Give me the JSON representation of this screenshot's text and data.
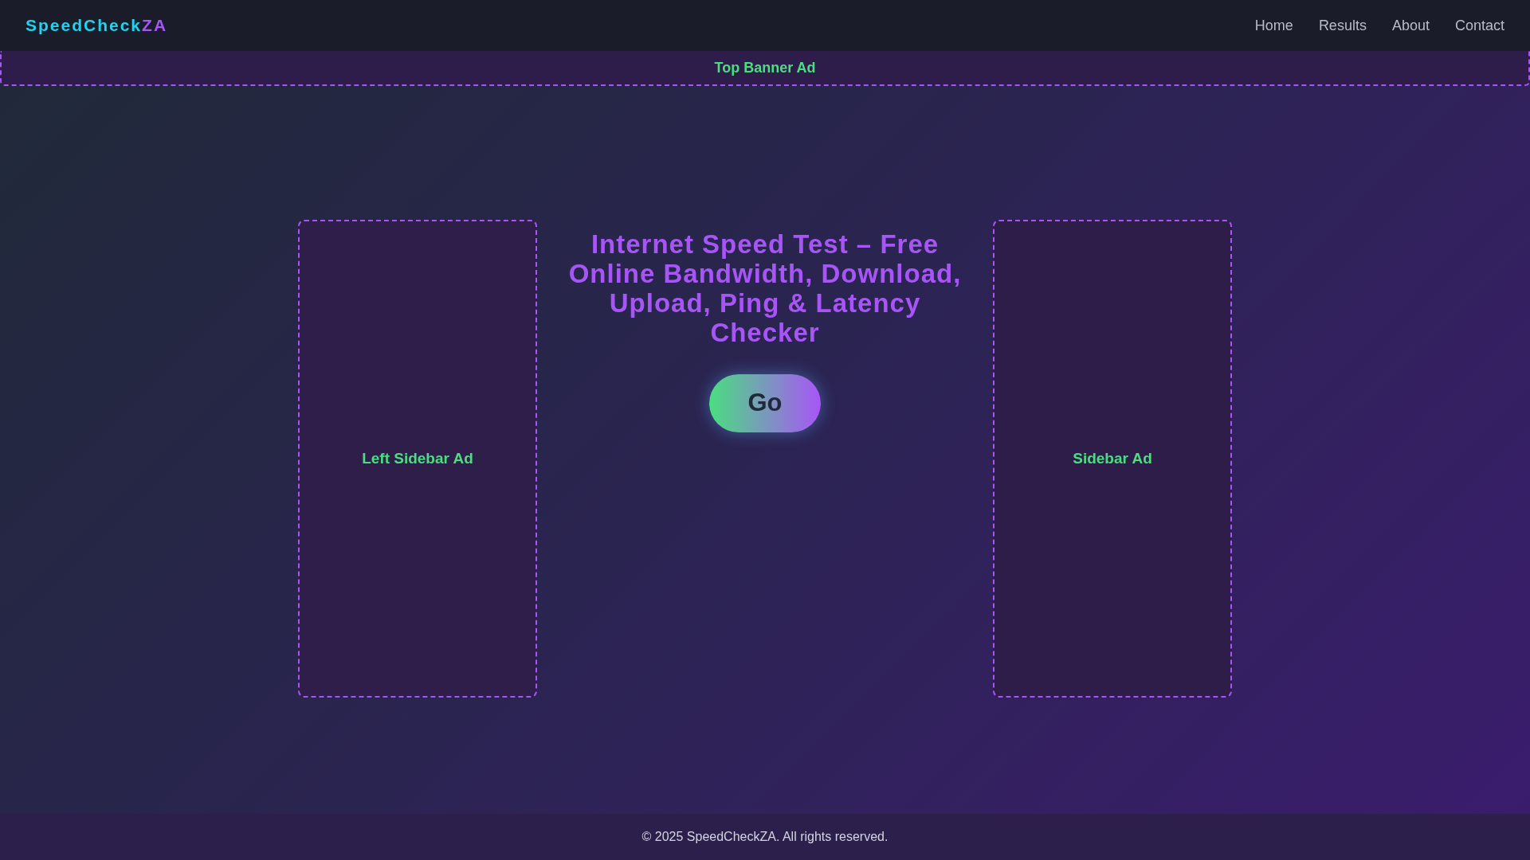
{
  "header": {
    "logo": {
      "primary": "SpeedCheck",
      "accent": "ZA"
    },
    "nav": [
      {
        "label": "Home"
      },
      {
        "label": "Results"
      },
      {
        "label": "About"
      },
      {
        "label": "Contact"
      }
    ]
  },
  "top_banner": {
    "label": "Top Banner Ad"
  },
  "left_sidebar": {
    "label": "Left Sidebar Ad"
  },
  "main": {
    "title": "Internet Speed Test – Free Online Bandwidth, Download, Upload, Ping & Latency Checker",
    "button": "Go"
  },
  "right_sidebar": {
    "label": "Sidebar Ad"
  },
  "footer": {
    "text": "© 2025 SpeedCheckZA. All rights reserved."
  }
}
